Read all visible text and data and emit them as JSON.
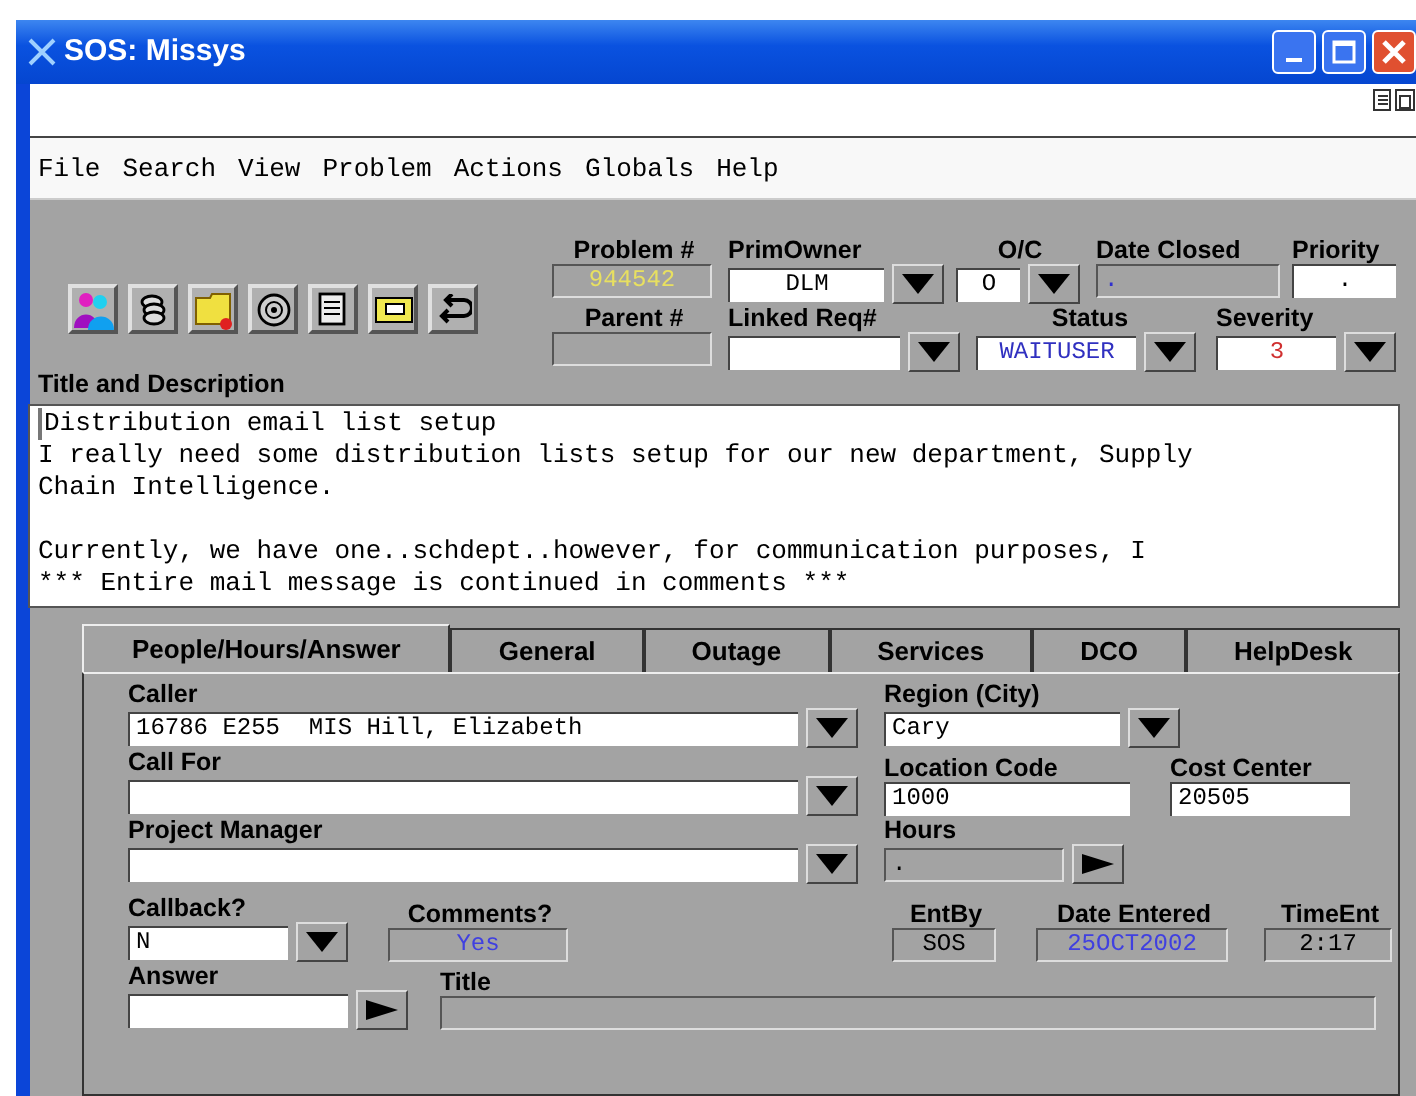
{
  "window": {
    "title": "SOS: Missys"
  },
  "menu": [
    "File",
    "Search",
    "View",
    "Problem",
    "Actions",
    "Globals",
    "Help"
  ],
  "header_rows": [
    [
      {
        "label": "Problem #",
        "value": "944542",
        "kind": "readonly",
        "color": "#e8e060"
      },
      {
        "label": "PrimOwner",
        "value": "DLM",
        "kind": "dropdown"
      },
      {
        "label": "O/C",
        "value": "O",
        "kind": "dropdown"
      },
      {
        "label": "Date Closed",
        "value": ".",
        "kind": "readonly",
        "color": "#3030d0"
      },
      {
        "label": "Priority",
        "value": ".",
        "kind": "input"
      }
    ],
    [
      {
        "label": "Parent #",
        "kind": "readonly"
      },
      {
        "label": "Linked Req#",
        "kind": "dropdown"
      },
      {
        "label": "Status",
        "value": "WAITUSER",
        "kind": "dropdown",
        "color": "#3030c0"
      },
      {
        "label": "Severity",
        "value": "3",
        "kind": "dropdown",
        "color": "#d03030"
      }
    ]
  ],
  "description": {
    "label": "Title and Description",
    "paragraphs": [
      [
        "Distribution email list setup",
        "I really need some distribution lists setup for our new department, Supply",
        "Chain Intelligence."
      ],
      [
        "Currently, we have one..schdept..however, for communication purposes, I",
        "*** Entire mail message is continued in comments ***"
      ]
    ]
  },
  "tabs": [
    {
      "label": "People/Hours/Answer",
      "selected": true
    },
    {
      "label": "General",
      "selected": false
    },
    {
      "label": "Outage",
      "selected": false
    },
    {
      "label": "Services",
      "selected": false
    },
    {
      "label": "DCO",
      "selected": false
    },
    {
      "label": "HelpDesk",
      "selected": false
    }
  ],
  "panel_rows": [
    [
      {
        "label": "Caller",
        "value": "16786 E255  MIS Hill, Elizabeth",
        "kind": "dropdown"
      },
      {
        "label": "Region (City)",
        "value": "Cary",
        "kind": "dropdown"
      }
    ],
    [
      {
        "label": "Call For",
        "kind": "dropdown"
      },
      {
        "label": "Location Code",
        "value": "1000",
        "kind": "input"
      },
      {
        "label": "Cost Center",
        "value": "20505",
        "kind": "input"
      }
    ],
    [
      {
        "label": "Project Manager",
        "kind": "dropdown"
      },
      {
        "label": "Hours",
        "value": ".",
        "kind": "arrow"
      }
    ],
    [
      {
        "label": "Callback?",
        "value": "N",
        "kind": "dropdown"
      },
      {
        "label": "Comments?",
        "value": "Yes",
        "kind": "readonly",
        "color": "#4040e0"
      },
      {
        "label": "EntBy",
        "value": "SOS",
        "kind": "readonly"
      },
      {
        "label": "Date Entered",
        "value": "25OCT2002",
        "kind": "readonly",
        "color": "#4040e0"
      },
      {
        "label": "TimeEnt",
        "value": "2:17",
        "kind": "readonly"
      }
    ],
    [
      {
        "label": "Answer",
        "kind": "arrow-input"
      },
      {
        "label": "Title",
        "kind": "readonly"
      }
    ]
  ]
}
